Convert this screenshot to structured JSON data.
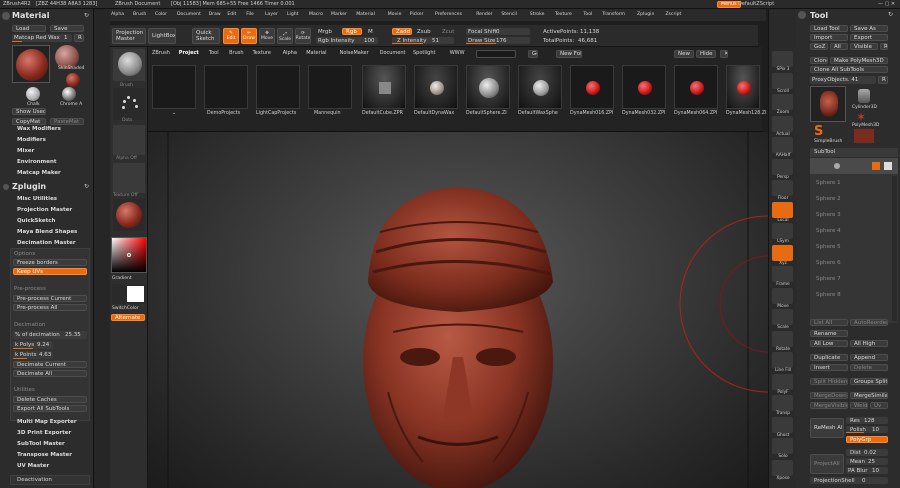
{
  "menubar": {
    "app": "ZBrush4R2",
    "info": "[ZBZ 44H38 A8A3 1283]",
    "doc": "ZBrush Document",
    "stats": "[Obj 11583] Mem 685+55 Free 1466 Timer 0.001",
    "items": [
      "Alpha",
      "Brush",
      "Color",
      "Document",
      "Draw",
      "Edit",
      "File",
      "Layer",
      "Light",
      "Macro",
      "Marker",
      "Material",
      "Movie",
      "Picker",
      "Preferences",
      "Render",
      "Stencil",
      "Stroke",
      "Texture",
      "Tool",
      "Transform",
      "Zplugin",
      "Zscript"
    ],
    "menus_btn": "Menus",
    "script": "DefaultZScript"
  },
  "left": {
    "material_title": "Material",
    "load": "Load",
    "save": "Save",
    "matcap": "Matcap Red Wax",
    "matcap_num": "1",
    "r": "R",
    "mat_labels": [
      "",
      "SkinShade4",
      "",
      "Chalk",
      "Chrome A"
    ],
    "show_used": "Show Used",
    "copymat": "CopyMat",
    "pastemat": "PasteMat",
    "plugin_items": [
      "Wax Modifiers",
      "Modifiers",
      "Mixer",
      "Environment",
      "Matcap Maker"
    ],
    "zplugin_title": "Zplugin",
    "zplugin_items": [
      "Misc Utilities",
      "Projection Master",
      "QuickSketch",
      "Maya Blend Shapes",
      "Decimation Master"
    ],
    "decimation": {
      "options": "Options",
      "freeze_borders": "Freeze borders",
      "keep_uvs": "Keep UVs",
      "preprocess": "Pre-process",
      "preprocess_current": "Pre-process Current",
      "preprocess_all": "Pre-process All",
      "decimation": "Decimation",
      "pct_label": "% of decimation",
      "pct_value": "25.35",
      "k_polys_label": "k Polys",
      "k_polys_value": "9.24",
      "k_points_label": "k Points",
      "k_points_value": "4.63",
      "decimate_current": "Decimate Current",
      "decimate_all": "Decimate All",
      "utilities": "Utilities",
      "delete_caches": "Delete Caches",
      "export_all": "Export All SubTools"
    },
    "bottom_items": [
      "Multi Map Exporter",
      "3D Print Exporter",
      "SubTool Master",
      "Transpose Master",
      "UV Master"
    ],
    "deactivation": "Deactivation"
  },
  "sidecol": {
    "labels": [
      "Brush",
      "Dots",
      "Alpha Off",
      "Texture Off",
      "Material",
      "Gradient",
      "SwitchColor",
      "Alternate"
    ]
  },
  "toolbar": {
    "projection_master": "Projection Master",
    "lightbox": "LightBox",
    "quick_sketch": "Quick Sketch",
    "edit": "Edit",
    "draw": "Draw",
    "move": "Move",
    "scale": "Scale",
    "rotate": "Rotate",
    "mrgb": "Mrgb",
    "rgb": "Rgb",
    "m": "M",
    "rgb_intensity_label": "Rgb Intensity",
    "rgb_intensity_value": "100",
    "zadd": "Zadd",
    "zsub": "Zsub",
    "zcut": "Zcut",
    "z_intensity_label": "Z Intensity",
    "z_intensity_value": "51",
    "focal_shift_label": "Focal Shift",
    "focal_shift_value": "0",
    "draw_size_label": "Draw Size",
    "draw_size_value": "176",
    "active_points_label": "ActivePoints:",
    "active_points_value": "11,138",
    "total_points_label": "TotalPoints:",
    "total_points_value": "46,681"
  },
  "lightbox": {
    "tabs": [
      "ZBrush",
      "Project",
      "Tool",
      "Brush",
      "Texture",
      "Alpha",
      "Material",
      "NoiseMaker",
      "Document",
      "Spotlight",
      "WWW"
    ],
    "active_tab": "Project",
    "go": "Go",
    "new_folder": "New Folder",
    "hide": "Hide",
    "new": "New",
    "items": [
      "DemoProjects",
      "LightCapProjects",
      "Mannequin",
      "DefaultCube.ZPR",
      "DefaultDynaWax",
      "DefaultSphere.ZI",
      "DefaultWaxSphe",
      "DynaMesh016.ZPI",
      "DynaMesh032.ZPI",
      "DynaMesh064.ZPI",
      "DynaMesh128.ZI"
    ]
  },
  "rightstrip": {
    "labels": [
      "SPix 3",
      "Scroll",
      "Zoom",
      "Actual",
      "AAHalf",
      "Persp",
      "Floor",
      "Local",
      "LSym",
      "Xyz",
      "Frame",
      "Move",
      "Scale",
      "Rotate",
      "Line Fill",
      "PolyF",
      "Transp",
      "Ghost",
      "Solo",
      "Xpose"
    ]
  },
  "right": {
    "tool_title": "Tool",
    "load_tool": "Load Tool",
    "save_as": "Save As",
    "import": "Import",
    "export": "Export",
    "goz": "GoZ",
    "all": "All",
    "visible": "Visible",
    "r": "R",
    "clone": "Clone",
    "make_polymesh": "Make PolyMesh3D",
    "clone_all": "Clone All SubTools",
    "proxy": "ProxyObjects. 41",
    "tool_thumbs": [
      "Cylinder3D",
      "PolyMesh3D",
      "SimpleBrush"
    ],
    "subtool": "SubTool",
    "subtool_slots": [
      "Sphere 1",
      "Sphere 2",
      "Sphere 3",
      "Sphere 4",
      "Sphere 5",
      "Sphere 6",
      "Sphere 7",
      "Sphere 8"
    ],
    "list_all": "List All",
    "auto_reorder": "AutoReorder",
    "rename": "Rename",
    "all_low": "All Low",
    "all_high": "All High",
    "duplicate": "Duplicate",
    "append": "Append",
    "insert": "Insert",
    "delete": "Delete",
    "split_hidden": "Split Hidden",
    "groups_split": "Groups Split",
    "merge_down": "MergeDown",
    "merge_similar": "MergeSimilar",
    "merge_visible": "MergeVisible",
    "weld": "Weld",
    "uv": "Uv",
    "remesh_all": "ReMesh All",
    "res_label": "Res",
    "res_value": "128",
    "polish_label": "Polish",
    "polish_value": "10",
    "polygrp": "PolyGrp",
    "project_all": "ProjectAll",
    "dist_label": "Dist",
    "dist_value": "0.02",
    "mean_label": "Mean",
    "mean_value": "25",
    "pa_blur_label": "PA Blur",
    "pa_blur_value": "10",
    "projection_shell_label": "ProjectionShell",
    "projection_shell_value": "0"
  },
  "colors": {
    "accent": "#e96b11",
    "panel": "#2c2c2c",
    "red_wax": "#8a2b20"
  }
}
